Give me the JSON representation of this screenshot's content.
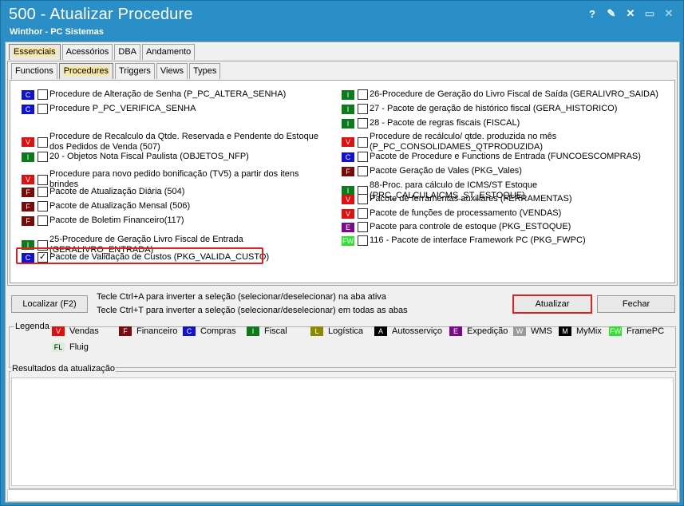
{
  "window": {
    "title": "500 - Atualizar Procedure",
    "subtitle": "Winthor - PC Sistemas",
    "buttons": [
      "?",
      "✎",
      "✕",
      "▭",
      "✕"
    ]
  },
  "tabs_main": [
    "Essenciais",
    "Acessórios",
    "DBA",
    "Andamento"
  ],
  "tabs_sub": [
    "Functions",
    "Procedures",
    "Triggers",
    "Views",
    "Types"
  ],
  "colors": {
    "V": "#e01010",
    "F": "#7a0a0a",
    "C": "#1010d8",
    "I": "#0a7a1a",
    "L": "#8a8a00",
    "A": "#000000",
    "E": "#7a0a8a",
    "W": "#9a9a9a",
    "M": "#000000",
    "FW": "#30e030",
    "FL": "#d8f0d8"
  },
  "left_items": [
    {
      "badge": "C",
      "checked": false,
      "label": "Procedure de Alteração de Senha (P_PC_ALTERA_SENHA)"
    },
    {
      "badge": "C",
      "checked": false,
      "label": "Procedure P_PC_VERIFICA_SENHA"
    },
    {
      "badge": "V",
      "checked": false,
      "label": "Procedure de Recalculo da Qtde. Reservada e Pendente do Estoque dos Pedidos de Venda (507)"
    },
    {
      "badge": "I",
      "checked": false,
      "label": "20 - Objetos Nota Fiscal Paulista (OBJETOS_NFP)"
    },
    {
      "badge": "V",
      "checked": false,
      "label": "Procedure para novo pedido bonificação (TV5) a partir dos itens brindes"
    },
    {
      "badge": "F",
      "checked": false,
      "label": "Pacote de Atualização Diária (504)"
    },
    {
      "badge": "F",
      "checked": false,
      "label": "Pacote de Atualização Mensal (506)"
    },
    {
      "badge": "F",
      "checked": false,
      "label": "Pacote de Boletim Financeiro(117)"
    },
    {
      "badge": "I",
      "checked": false,
      "label": "25-Procedure de Geração Livro Fiscal de Entrada (GERALIVRO_ENTRADA)"
    },
    {
      "badge": "C",
      "checked": true,
      "label": "Pacote de Validação de Custos (PKG_VALIDA_CUSTO)"
    }
  ],
  "right_items": [
    {
      "badge": "I",
      "checked": false,
      "label": "26-Procedure de Geração do Livro Fiscal de Saída (GERALIVRO_SAIDA)"
    },
    {
      "badge": "I",
      "checked": false,
      "label": "27 - Pacote de geração de histórico fiscal (GERA_HISTORICO)"
    },
    {
      "badge": "I",
      "checked": false,
      "label": "28 - Pacote de regras fiscais (FISCAL)"
    },
    {
      "badge": "V",
      "checked": false,
      "label": "Procedure de recálculo/ qtde. produzida no mês (P_PC_CONSOLIDAMES_QTPRODUZIDA)"
    },
    {
      "badge": "C",
      "checked": false,
      "label": "Pacote de Procedure e Functions de Entrada (FUNCOESCOMPRAS)"
    },
    {
      "badge": "F",
      "checked": false,
      "label": "Pacote Geração de Vales (PKG_Vales)"
    },
    {
      "badge": "I",
      "checked": false,
      "label": "88-Proc. para cálculo de ICMS/ST Estoque (PRC_CALCULAICMS_ST_ESTOQUE)"
    },
    {
      "badge": "V",
      "checked": false,
      "label": "Pacote de ferramentas auxiliares (FERRAMENTAS)"
    },
    {
      "badge": "V",
      "checked": false,
      "label": "Pacote de funções de processamento (VENDAS)"
    },
    {
      "badge": "E",
      "checked": false,
      "label": "Pacote para controle de estoque (PKG_ESTOQUE)"
    },
    {
      "badge": "FW",
      "checked": false,
      "label": "116 - Pacote de interface Framework PC (PKG_FWPC)"
    }
  ],
  "actions": {
    "localizar": "Localizar (F2)",
    "hint1": "Tecle Ctrl+A para inverter a seleção (selecionar/deselecionar) na aba ativa",
    "hint2": "Tecle Ctrl+T para inverter a seleção (selecionar/deselecionar) em todas as abas",
    "atualizar": "Atualizar",
    "fechar": "Fechar"
  },
  "legend": {
    "title": "Legenda",
    "items": [
      {
        "badge": "V",
        "label": "Vendas"
      },
      {
        "badge": "F",
        "label": "Financeiro"
      },
      {
        "badge": "C",
        "label": "Compras"
      },
      {
        "badge": "I",
        "label": "Fiscal"
      },
      {
        "badge": "L",
        "label": "Logística"
      },
      {
        "badge": "A",
        "label": "Autosserviço"
      },
      {
        "badge": "E",
        "label": "Expedição"
      },
      {
        "badge": "W",
        "label": "WMS"
      },
      {
        "badge": "M",
        "label": "MyMix"
      },
      {
        "badge": "FW",
        "label": "FramePC"
      },
      {
        "badge": "FL",
        "label": "Fluig"
      }
    ]
  },
  "results": {
    "title": "Resultados da atualização"
  }
}
